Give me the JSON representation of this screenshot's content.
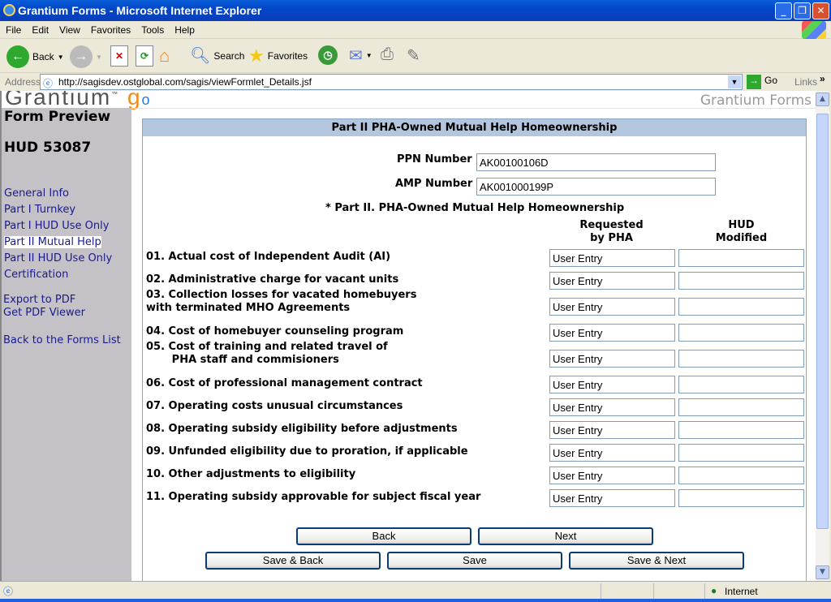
{
  "window": {
    "title": "Grantium Forms - Microsoft Internet Explorer"
  },
  "menu": [
    "File",
    "Edit",
    "View",
    "Favorites",
    "Tools",
    "Help"
  ],
  "toolbar": {
    "back": "Back",
    "search": "Search",
    "favorites": "Favorites"
  },
  "address": {
    "label": "Address",
    "url": "http://sagisdev.ostglobal.com/sagis/viewFormlet_Details.jsf",
    "go": "Go",
    "links": "Links"
  },
  "page": {
    "logo": "Grantium™ g",
    "brand": "Grantium Forms"
  },
  "sidebar": {
    "title": "Form Preview",
    "form_id": "HUD 53087",
    "nav": [
      "General Info",
      "Part I Turnkey",
      "Part I HUD Use Only",
      "Part II Mutual Help",
      "Part II HUD Use Only",
      "Certification"
    ],
    "selected": 3,
    "export": "Export to PDF",
    "viewer": "Get PDF Viewer",
    "back_list": "Back to the Forms List"
  },
  "form": {
    "header": "Part II PHA-Owned Mutual Help Homeownership",
    "ppn_label": "PPN Number",
    "ppn_value": "AK00100106D",
    "amp_label": "AMP Number",
    "amp_value": "AK001000199P",
    "section": "* Part II. PHA-Owned Mutual Help Homeownership",
    "col_requested": [
      "Requested",
      "by PHA"
    ],
    "col_hud": [
      "HUD",
      "Modified"
    ],
    "rows": [
      {
        "label": [
          "01. Actual cost of Independent Audit (AI)"
        ],
        "requested": "User Entry",
        "hud": ""
      },
      {
        "label": [
          "02. Administrative charge for vacant units"
        ],
        "requested": "User Entry",
        "hud": ""
      },
      {
        "label": [
          "03. Collection losses for vacated homebuyers",
          "with terminated MHO Agreements"
        ],
        "requested": "User Entry",
        "hud": ""
      },
      {
        "label": [
          "04. Cost of homebuyer counseling program"
        ],
        "requested": "User Entry",
        "hud": ""
      },
      {
        "label": [
          "05. Cost of training and related travel of",
          "       PHA staff and commisioners"
        ],
        "requested": "User Entry",
        "hud": ""
      },
      {
        "label": [
          "06. Cost of professional management contract"
        ],
        "requested": "User Entry",
        "hud": ""
      },
      {
        "label": [
          "07. Operating costs unusual circumstances"
        ],
        "requested": "User Entry",
        "hud": ""
      },
      {
        "label": [
          "08. Operating subsidy eligibility before adjustments"
        ],
        "requested": "User Entry",
        "hud": ""
      },
      {
        "label": [
          "09. Unfunded eligibility due to proration, if applicable"
        ],
        "requested": "User Entry",
        "hud": ""
      },
      {
        "label": [
          "10. Other adjustments to eligibility"
        ],
        "requested": "User Entry",
        "hud": ""
      },
      {
        "label": [
          "11. Operating subsidy approvable for subject fiscal year"
        ],
        "requested": "User Entry",
        "hud": ""
      }
    ],
    "buttons": {
      "back": "Back",
      "next": "Next",
      "save_back": "Save & Back",
      "save": "Save",
      "save_next": "Save & Next"
    }
  },
  "status": {
    "zone": "Internet"
  }
}
